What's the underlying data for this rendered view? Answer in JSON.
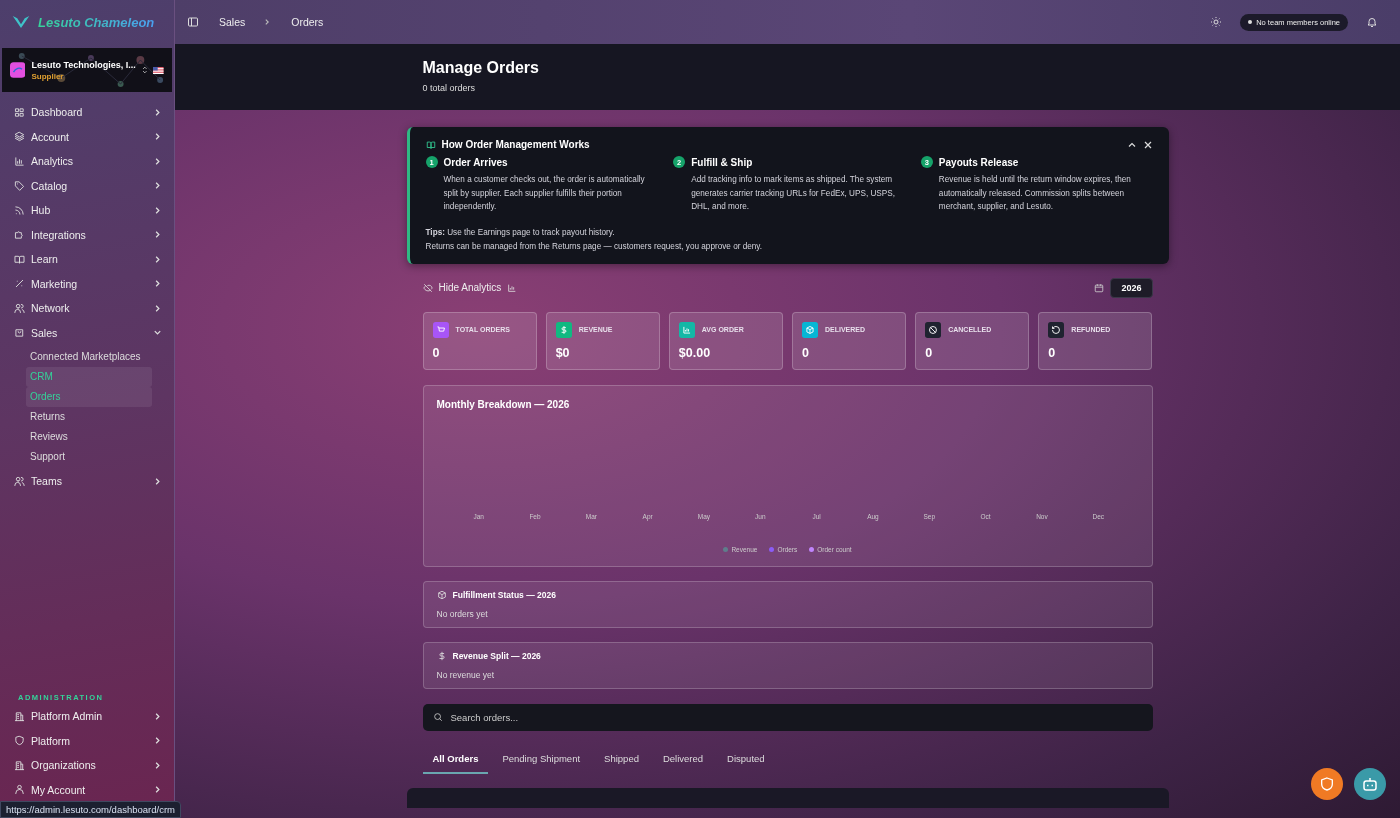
{
  "brand": {
    "name": "Lesuto Chameleon"
  },
  "breadcrumb": [
    "Sales",
    "Orders"
  ],
  "topbar": {
    "presence": "No team members online"
  },
  "company": {
    "name": "Lesuto Technologies, I...",
    "role": "Supplier"
  },
  "sidebar": {
    "items": [
      {
        "label": "Dashboard",
        "expanded": false
      },
      {
        "label": "Account",
        "expanded": false
      },
      {
        "label": "Analytics",
        "expanded": false
      },
      {
        "label": "Catalog",
        "expanded": false
      },
      {
        "label": "Hub",
        "expanded": false
      },
      {
        "label": "Integrations",
        "expanded": false
      },
      {
        "label": "Learn",
        "expanded": false
      },
      {
        "label": "Marketing",
        "expanded": false
      },
      {
        "label": "Network",
        "expanded": false
      },
      {
        "label": "Sales",
        "expanded": true,
        "children": [
          {
            "label": "Connected Marketplaces",
            "selected": false
          },
          {
            "label": "CRM",
            "selected": true
          },
          {
            "label": "Orders",
            "selected": true
          },
          {
            "label": "Returns",
            "selected": false
          },
          {
            "label": "Reviews",
            "selected": false
          },
          {
            "label": "Support",
            "selected": false
          }
        ]
      },
      {
        "label": "Teams",
        "expanded": false
      }
    ],
    "admin_heading": "ADMINISTRATION",
    "admin_items": [
      {
        "label": "Platform Admin"
      },
      {
        "label": "Platform"
      },
      {
        "label": "Organizations"
      },
      {
        "label": "My Account"
      }
    ]
  },
  "status_bar": {
    "url": "https://admin.lesuto.com/dashboard/crm"
  },
  "header": {
    "title": "Manage **Orders**",
    "subtitle": "0 total orders"
  },
  "info_card": {
    "title": "How Order Management Works",
    "steps": [
      {
        "number": "1",
        "title": "Order Arrives",
        "text": "When a customer checks out, the order is automatically split by supplier. Each supplier fulfills their portion independently."
      },
      {
        "number": "2",
        "title": "Fulfill & Ship",
        "text": "Add tracking info to mark items as shipped. The system generates carrier tracking URLs for FedEx, UPS, USPS, DHL, and more."
      },
      {
        "number": "3",
        "title": "Payouts Release",
        "text": "Revenue is held until the return window expires, then automatically released. Commission splits between merchant, supplier, and Lesuto."
      }
    ],
    "tips": [
      "**Tips:** Use the Earnings page to track payout history.",
      "Returns can be managed from the Returns page — customers request, you approve or deny."
    ]
  },
  "analytics": {
    "toggle": "Hide Analytics",
    "year": "2026"
  },
  "stats": [
    {
      "label": "TOTAL ORDERS",
      "value": "0",
      "color": "#a855f7"
    },
    {
      "label": "REVENUE",
      "value": "$0",
      "color": "#10b981"
    },
    {
      "label": "AVG ORDER",
      "value": "$0.00",
      "color": "#14b8a6"
    },
    {
      "label": "DELIVERED",
      "value": "0",
      "color": "#06b6d4"
    },
    {
      "label": "CANCELLED",
      "value": "0",
      "color": "#1f2330"
    },
    {
      "label": "REFUNDED",
      "value": "0",
      "color": "#1f2330"
    }
  ],
  "monthly": {
    "title": "Monthly Breakdown — 2026",
    "months": [
      "Jan",
      "Feb",
      "Mar",
      "Apr",
      "May",
      "Jun",
      "Jul",
      "Aug",
      "Sep",
      "Oct",
      "Nov",
      "Dec"
    ],
    "legend": [
      {
        "label": "Revenue",
        "color": "#5f7d8c"
      },
      {
        "label": "Orders",
        "color": "#8b5cf6"
      },
      {
        "label": "Order count",
        "color": "#c084fc"
      }
    ]
  },
  "fulfillment": {
    "title": "Fulfillment Status — 2026",
    "empty": "No orders yet"
  },
  "revenue_split": {
    "title": "Revenue Split — 2026",
    "empty": "No revenue yet"
  },
  "search": {
    "placeholder": "Search orders..."
  },
  "tabs": [
    {
      "label": "All Orders",
      "selected": true
    },
    {
      "label": "Pending Shipment",
      "selected": false
    },
    {
      "label": "Shipped",
      "selected": false
    },
    {
      "label": "Delivered",
      "selected": false
    },
    {
      "label": "Disputed",
      "selected": false
    }
  ]
}
